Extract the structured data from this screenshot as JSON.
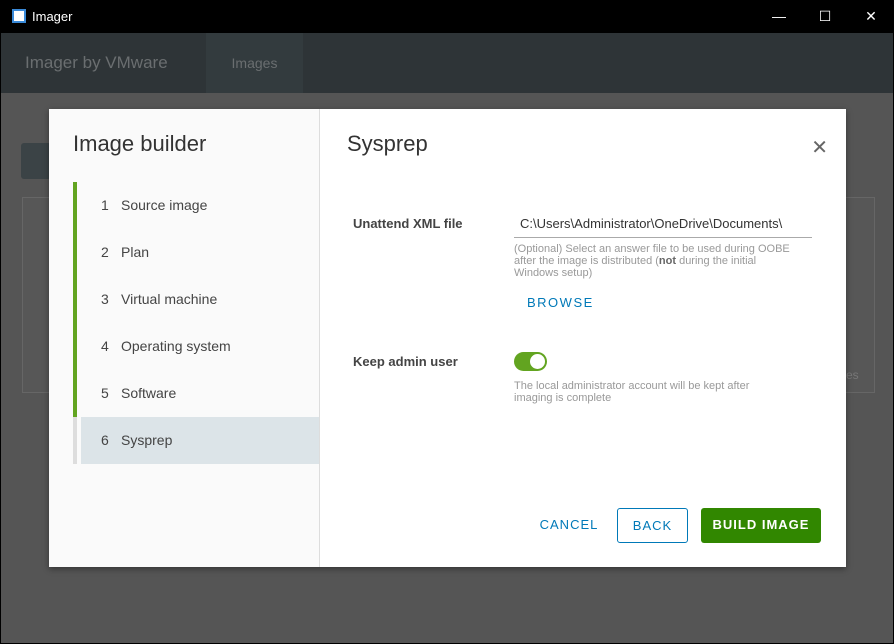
{
  "window": {
    "title": "Imager",
    "minimize": "—",
    "maximize": "☐",
    "close": "✕"
  },
  "header": {
    "brand": "Imager by VMware",
    "tab": "Images"
  },
  "background": {
    "partial_text": "es"
  },
  "modal": {
    "sidebar_title": "Image builder",
    "steps": [
      {
        "n": "1",
        "label": "Source image"
      },
      {
        "n": "2",
        "label": "Plan"
      },
      {
        "n": "3",
        "label": "Virtual machine"
      },
      {
        "n": "4",
        "label": "Operating system"
      },
      {
        "n": "5",
        "label": "Software"
      },
      {
        "n": "6",
        "label": "Sysprep"
      }
    ],
    "title": "Sysprep",
    "unattend": {
      "label": "Unattend XML file",
      "value": "C:\\Users\\Administrator\\OneDrive\\Documents\\",
      "help_pre": "(Optional) Select an answer file to be used during OOBE after the image is distributed (",
      "help_bold": "not",
      "help_post": " during the initial Windows setup)",
      "browse": "BROWSE"
    },
    "keep_admin": {
      "label": "Keep admin user",
      "enabled": true,
      "help": "The local administrator account will be kept after imaging is complete"
    },
    "buttons": {
      "cancel": "CANCEL",
      "back": "BACK",
      "build": "BUILD IMAGE"
    },
    "colors": {
      "accent": "#0079b8",
      "success": "#62a420",
      "build": "#318700"
    }
  }
}
